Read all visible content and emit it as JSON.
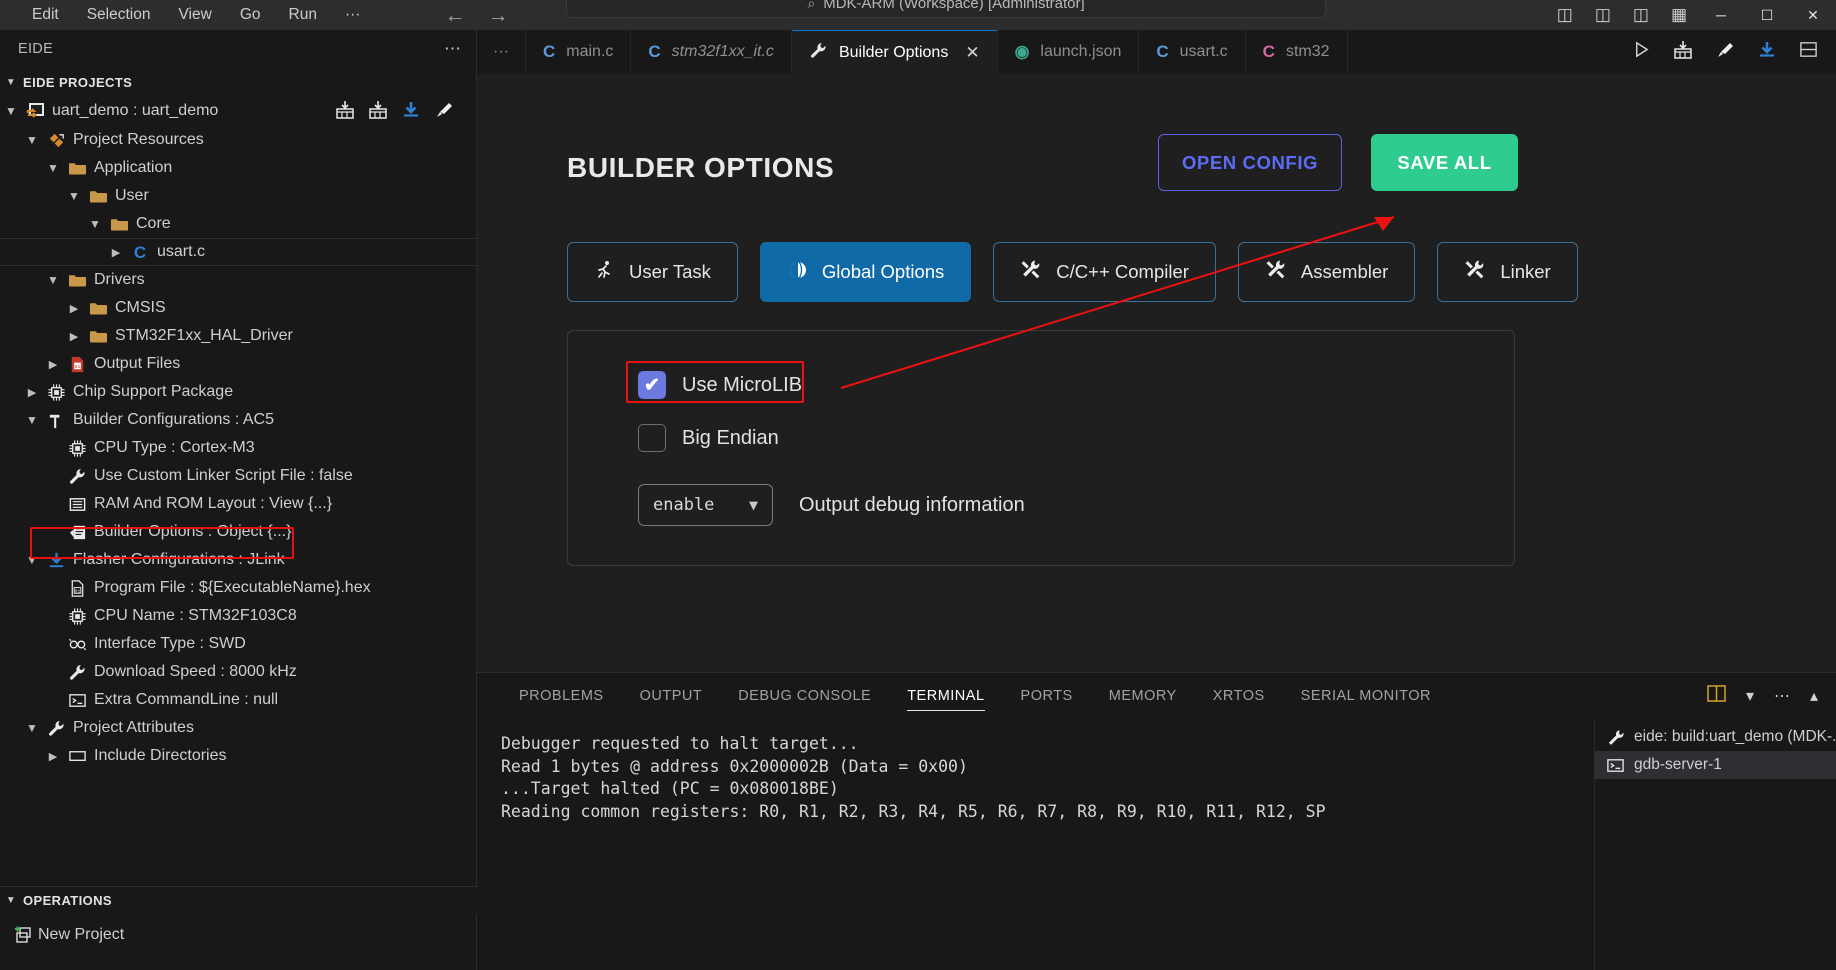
{
  "titlebar": {
    "menus": [
      "Edit",
      "Selection",
      "View",
      "Go",
      "Run",
      "···"
    ],
    "back_icon": "←",
    "forward_icon": "→",
    "search_icon": "⌕",
    "search_text": "MDK-ARM (Workspace) [Administrator]",
    "layout_icons": [
      "❙▭",
      "▭❙",
      "▭▔",
      "▦"
    ],
    "minimize": "─",
    "maximize": "☐",
    "close": "✕"
  },
  "sidebar": {
    "view_title": "EIDE",
    "more_actions_icon": "⋯",
    "section_title": "EIDE PROJECTS",
    "project_row": {
      "label": "uart_demo : uart_demo",
      "actions": [
        "build-icon",
        "rebuild-icon",
        "download-icon",
        "clean-icon"
      ]
    },
    "tree": [
      {
        "label": "Project Resources",
        "indent": 1,
        "twisty": "⌄",
        "icon": "resources-icon"
      },
      {
        "label": "Application",
        "indent": 2,
        "twisty": "⌄",
        "icon": "folder-icon"
      },
      {
        "label": "User",
        "indent": 3,
        "twisty": "⌄",
        "icon": "folder-icon"
      },
      {
        "label": "Core",
        "indent": 4,
        "twisty": "⌄",
        "icon": "folder-icon"
      },
      {
        "label": "usart.c",
        "indent": 5,
        "twisty": "›",
        "icon": "c-file-icon"
      },
      {
        "label": "Drivers",
        "indent": 2,
        "twisty": "⌄",
        "icon": "folder-icon"
      },
      {
        "label": "CMSIS",
        "indent": 3,
        "twisty": "›",
        "icon": "folder-icon"
      },
      {
        "label": "STM32F1xx_HAL_Driver",
        "indent": 3,
        "twisty": "›",
        "icon": "folder-icon"
      },
      {
        "label": "Output Files",
        "indent": 2,
        "twisty": "›",
        "icon": "output-files-icon"
      },
      {
        "label": "Chip Support Package",
        "indent": 1,
        "twisty": "›",
        "icon": "chip-icon"
      },
      {
        "label": "Builder Configurations : AC5",
        "indent": 1,
        "twisty": "⌄",
        "icon": "hammer-icon"
      },
      {
        "label": "CPU Type : Cortex-M3",
        "indent": 2,
        "twisty": "",
        "icon": "chip-icon"
      },
      {
        "label": "Use Custom Linker Script File : false",
        "indent": 2,
        "twisty": "",
        "icon": "wrench-icon"
      },
      {
        "label": "RAM And ROM Layout : View {...}",
        "indent": 2,
        "twisty": "",
        "icon": "memory-icon"
      },
      {
        "label": "Builder Options : Object {...}",
        "indent": 2,
        "twisty": "",
        "icon": "options-icon"
      },
      {
        "label": "Flasher Configurations : JLink",
        "indent": 1,
        "twisty": "⌄",
        "icon": "download-icon"
      },
      {
        "label": "Program File : ${ExecutableName}.hex",
        "indent": 2,
        "twisty": "",
        "icon": "binary-file-icon"
      },
      {
        "label": "CPU Name : STM32F103C8",
        "indent": 2,
        "twisty": "",
        "icon": "chip-icon"
      },
      {
        "label": "Interface Type : SWD",
        "indent": 2,
        "twisty": "",
        "icon": "plug-icon"
      },
      {
        "label": "Download Speed : 8000 kHz",
        "indent": 2,
        "twisty": "",
        "icon": "wrench-icon"
      },
      {
        "label": "Extra CommandLine : null",
        "indent": 2,
        "twisty": "",
        "icon": "terminal-icon"
      },
      {
        "label": "Project Attributes",
        "indent": 1,
        "twisty": "⌄",
        "icon": "wrench-icon"
      },
      {
        "label": "Include Directories",
        "indent": 2,
        "twisty": "›",
        "icon": "include-icon"
      }
    ],
    "operations": {
      "section_title": "OPERATIONS",
      "items": [
        {
          "label": "New Project",
          "icon": "new-project-icon"
        }
      ]
    }
  },
  "editor_tabs": [
    {
      "label": "···",
      "kind": "overflow"
    },
    {
      "label": "main.c",
      "kind": "c",
      "state": "inactive"
    },
    {
      "label": "stm32f1xx_it.c",
      "kind": "c",
      "state": "preview"
    },
    {
      "label": "Builder Options",
      "kind": "wrench",
      "state": "active",
      "close": "✕"
    },
    {
      "label": "launch.json",
      "kind": "json",
      "state": "inactive"
    },
    {
      "label": "usart.c",
      "kind": "c",
      "state": "inactive"
    },
    {
      "label": "stm32",
      "kind": "c-pink",
      "state": "inactive"
    }
  ],
  "editor_actions": [
    "run-icon",
    "build-icon",
    "clean-icon",
    "download-icon",
    "split-editor-icon"
  ],
  "builder_options": {
    "title": "BUILDER OPTIONS",
    "open_config_label": "OPEN CONFIG",
    "save_all_label": "SAVE ALL",
    "accent_open_config": "#5c6cf5",
    "accent_save_all": "#2ecc8f",
    "accent_active_tab": "#116aa8",
    "accent_checkbox": "#6c7ae0",
    "annotation_color": "#ee1111",
    "tabs": [
      {
        "label": "User Task",
        "icon": "task-runner-icon",
        "active": false
      },
      {
        "label": "Global Options",
        "icon": "globe-icon",
        "active": true
      },
      {
        "label": "C/C++ Compiler",
        "icon": "tools-icon",
        "active": false
      },
      {
        "label": "Assembler",
        "icon": "tools-icon",
        "active": false
      },
      {
        "label": "Linker",
        "icon": "tools-icon",
        "active": false
      }
    ],
    "checkboxes": [
      {
        "label": "Use MicroLIB",
        "checked": true,
        "mark": "✔",
        "highlighted": true
      },
      {
        "label": "Big Endian",
        "checked": false,
        "mark": "",
        "highlighted": false
      }
    ],
    "select": {
      "value": "enable",
      "chevron": "⌄",
      "description": "Output debug information"
    }
  },
  "bottom_panel": {
    "tabs": [
      {
        "label": "PROBLEMS",
        "active": false
      },
      {
        "label": "OUTPUT",
        "active": false
      },
      {
        "label": "DEBUG CONSOLE",
        "active": false
      },
      {
        "label": "TERMINAL",
        "active": true
      },
      {
        "label": "PORTS",
        "active": false
      },
      {
        "label": "MEMORY",
        "active": false
      },
      {
        "label": "XRTOS",
        "active": false
      },
      {
        "label": "SERIAL MONITOR",
        "active": false
      }
    ],
    "actions": [
      "split-terminal-icon",
      "chevron-down-icon",
      "more-actions-icon",
      "chevron-up-icon"
    ],
    "terminal_lines": [
      "Debugger requested to halt target...",
      "Read 1 bytes @ address 0x2000002B (Data = 0x00)",
      "...Target halted (PC = 0x080018BE)",
      "Reading common registers: R0, R1, R2, R3, R4, R5, R6, R7, R8, R9, R10, R11, R12, SP"
    ],
    "terminal_list": [
      {
        "label": "eide: build:uart_demo (MDK-...",
        "icon": "tools-icon",
        "selected": false
      },
      {
        "label": "gdb-server-1",
        "icon": "terminal-icon",
        "selected": true
      }
    ]
  }
}
